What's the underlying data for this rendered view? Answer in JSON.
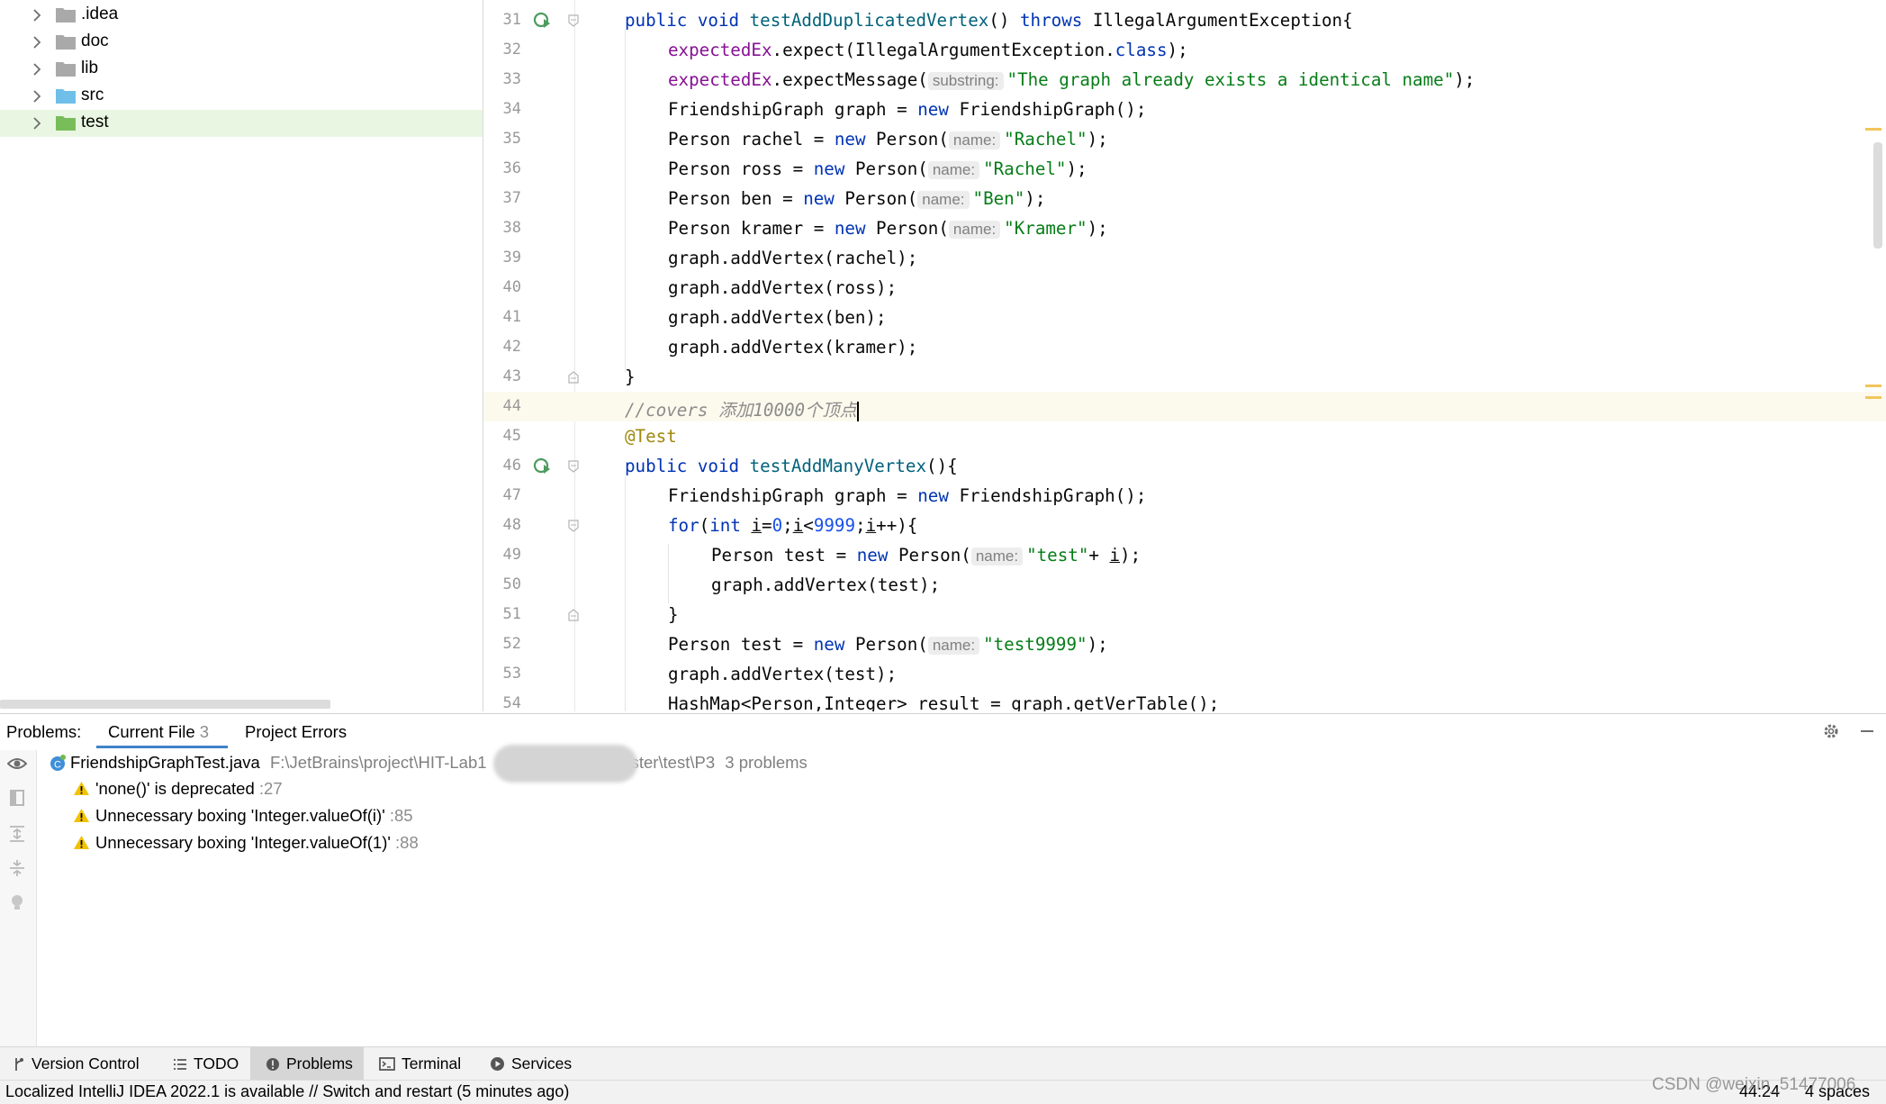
{
  "project_tree": {
    "items": [
      {
        "label": ".idea",
        "folder_color": "#a9a9a9"
      },
      {
        "label": "doc",
        "folder_color": "#a9a9a9"
      },
      {
        "label": "lib",
        "folder_color": "#a9a9a9"
      },
      {
        "label": "src",
        "folder_color": "#6fbfe8"
      },
      {
        "label": "test",
        "folder_color": "#79bd5a"
      }
    ],
    "selected": "test"
  },
  "editor": {
    "current_line": 44,
    "lines": [
      {
        "n": "31"
      },
      {
        "n": "32"
      },
      {
        "n": "33"
      },
      {
        "n": "34"
      },
      {
        "n": "35"
      },
      {
        "n": "36"
      },
      {
        "n": "37"
      },
      {
        "n": "38"
      },
      {
        "n": "39"
      },
      {
        "n": "40"
      },
      {
        "n": "41"
      },
      {
        "n": "42"
      },
      {
        "n": "43"
      },
      {
        "n": "44"
      },
      {
        "n": "45"
      },
      {
        "n": "46"
      },
      {
        "n": "47"
      },
      {
        "n": "48"
      },
      {
        "n": "49"
      },
      {
        "n": "50"
      },
      {
        "n": "51"
      },
      {
        "n": "52"
      },
      {
        "n": "53"
      },
      {
        "n": "54"
      }
    ],
    "code": {
      "l31": {
        "a": "public void ",
        "b": "testAddDuplicatedVertex",
        "c": "() ",
        "d": "throws",
        "e": " IllegalArgumentException{"
      },
      "l32": {
        "a": "expectedEx",
        "b": ".expect(IllegalArgumentException.",
        "c": "class",
        "d": ");"
      },
      "l33": {
        "a": "expectedEx",
        "b": ".expectMessage(",
        "hint": "substring:",
        "s": "\"The graph already exists a identical name\"",
        "d": ");"
      },
      "l34": {
        "a": "FriendshipGraph graph = ",
        "b": "new",
        "c": " FriendshipGraph();"
      },
      "l35": {
        "a": "Person rachel = ",
        "b": "new",
        "c": " Person(",
        "hint": "name:",
        "s": "\"Rachel\"",
        "d": ");"
      },
      "l36": {
        "a": "Person ross = ",
        "b": "new",
        "c": " Person(",
        "hint": "name:",
        "s": "\"Rachel\"",
        "d": ");"
      },
      "l37": {
        "a": "Person ben = ",
        "b": "new",
        "c": " Person(",
        "hint": "name:",
        "s": "\"Ben\"",
        "d": ");"
      },
      "l38": {
        "a": "Person kramer = ",
        "b": "new",
        "c": " Person(",
        "hint": "name:",
        "s": "\"Kramer\"",
        "d": ");"
      },
      "l39": {
        "a": "graph.addVertex(rachel);"
      },
      "l40": {
        "a": "graph.addVertex(ross);"
      },
      "l41": {
        "a": "graph.addVertex(ben);"
      },
      "l42": {
        "a": "graph.addVertex(kramer);"
      },
      "l43": {
        "a": "}"
      },
      "l44": {
        "a": "//covers 添加10000个顶点"
      },
      "l45": {
        "a": "@Test"
      },
      "l46": {
        "a": "public void ",
        "b": "testAddManyVertex",
        "c": "(){"
      },
      "l47": {
        "a": "FriendshipGraph graph = ",
        "b": "new",
        "c": " FriendshipGraph();"
      },
      "l48": {
        "a": "for",
        "b": "(",
        "c": "int",
        "d": " ",
        "e": "i",
        "f": "=",
        "g": "0",
        "h": ";",
        "i": "i",
        "j": "<",
        "k": "9999",
        "l": ";",
        "m": "i",
        "o": "++){"
      },
      "l49": {
        "a": "Person test = ",
        "b": "new",
        "c": " Person(",
        "hint": "name:",
        "s": "\"test\"",
        "d": "+ ",
        "e": "i",
        "f": ");"
      },
      "l50": {
        "a": "graph.addVertex(test);"
      },
      "l51": {
        "a": "}"
      },
      "l52": {
        "a": "Person test = ",
        "b": "new",
        "c": " Person(",
        "hint": "name:",
        "s": "\"test9999\"",
        "d": ");"
      },
      "l53": {
        "a": "graph.addVertex(test);"
      },
      "l54": {
        "a": "HashMap<Person,Integer> result = graph.getVerTable();"
      }
    }
  },
  "problems": {
    "title": "Problems:",
    "tabs": [
      {
        "label": "Current File",
        "count": "3"
      },
      {
        "label": "Project Errors"
      }
    ],
    "file": {
      "name": "FriendshipGraphTest.java",
      "path_start": "F:\\JetBrains\\project\\HIT-Lab1",
      "path_end": "ster\\test\\P3",
      "summary": "3 problems"
    },
    "items": [
      {
        "text": "'none()' is deprecated",
        "line": ":27"
      },
      {
        "text": "Unnecessary boxing 'Integer.valueOf(i)'",
        "line": ":85"
      },
      {
        "text": "Unnecessary boxing 'Integer.valueOf(1)'",
        "line": ":88"
      }
    ]
  },
  "toolbar": {
    "tabs": [
      "Version Control",
      "TODO",
      "Problems",
      "Terminal",
      "Services"
    ],
    "active": "Problems"
  },
  "status": {
    "message": "Localized IntelliJ IDEA 2022.1 is available // Switch and restart (5 minutes ago)",
    "position": "44:24",
    "indent": "4 spaces"
  },
  "watermark": "CSDN @weixin_51477006",
  "colors": {
    "keyword": "#0033b3",
    "string": "#067d17",
    "field": "#871094",
    "method": "#00627a",
    "number": "#1750eb",
    "annotation": "#9e880d",
    "comment": "#8c8c8c",
    "warning": "#f2c200",
    "selected_tree_bg": "#e9f7e2",
    "current_line_bg": "#fcfaed"
  },
  "icons": [
    "chevron-right-icon",
    "folder-icon",
    "run-test-icon",
    "fold-icon",
    "eye-icon",
    "warning-icon",
    "class-icon",
    "gear-icon",
    "minimize-icon",
    "branch-icon",
    "list-icon",
    "info-icon",
    "terminal-icon",
    "services-icon",
    "bulb-icon",
    "expand-all-icon",
    "collapse-all-icon",
    "preview-icon"
  ]
}
